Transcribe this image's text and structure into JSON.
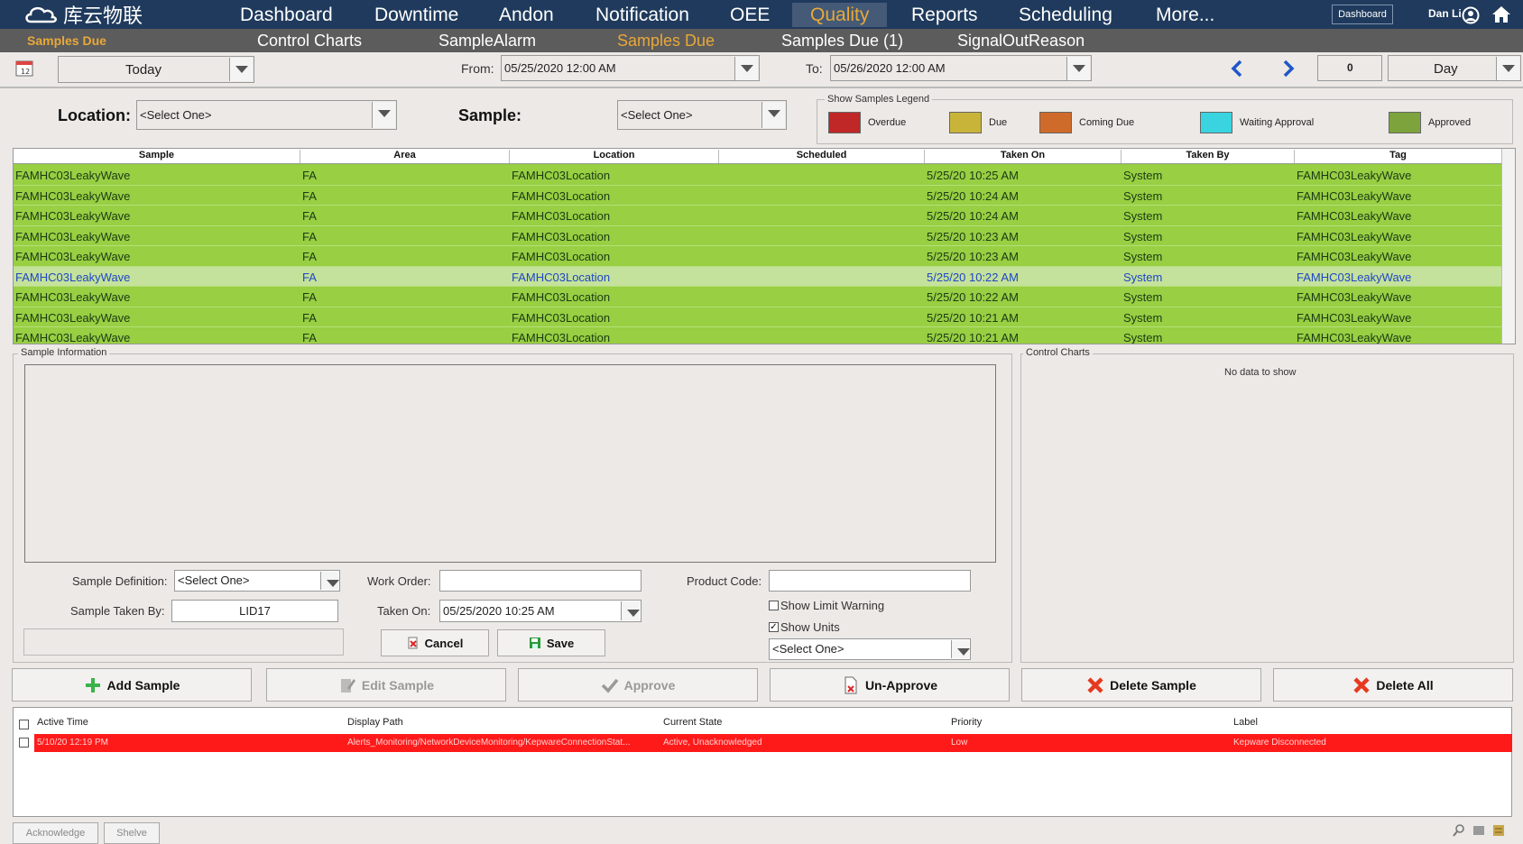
{
  "topnav": {
    "logo_text": "库云物联",
    "items": [
      "Dashboard",
      "Downtime",
      "Andon",
      "Notification",
      "OEE",
      "Quality",
      "Reports",
      "Scheduling",
      "More..."
    ],
    "dashboard_button": "Dashboard",
    "user": "Dan Li"
  },
  "subnav": {
    "page_title": "Samples Due",
    "items": [
      "Control Charts",
      "SampleAlarm",
      "Samples Due",
      "Samples Due (1)",
      "SignalOutReason"
    ]
  },
  "toolbar": {
    "range_value": "Today",
    "from_label": "From:",
    "from_value": "05/25/2020 12:00 AM",
    "to_label": "To:",
    "to_value": "05/26/2020 12:00 AM",
    "offset_value": "0",
    "period_value": "Day"
  },
  "filters": {
    "location_label": "Location:",
    "location_value": "<Select One>",
    "sample_label": "Sample:",
    "sample_value": "<Select One>"
  },
  "legend": {
    "title": "Show Samples Legend",
    "items": [
      {
        "label": "Overdue",
        "color": "#c02727"
      },
      {
        "label": "Due",
        "color": "#c9b43a"
      },
      {
        "label": "Coming Due",
        "color": "#cf6b2a"
      },
      {
        "label": "Waiting Approval",
        "color": "#39d4e0"
      },
      {
        "label": "Approved",
        "color": "#7da43c"
      }
    ]
  },
  "grid": {
    "columns": [
      "Sample",
      "Area",
      "Location",
      "Scheduled",
      "Taken On",
      "Taken By",
      "Tag"
    ],
    "rows": [
      [
        "FAMHC03LeakyWave",
        "FA",
        "FAMHC03Location",
        "",
        "5/25/20 10:25 AM",
        "System",
        "FAMHC03LeakyWave"
      ],
      [
        "FAMHC03LeakyWave",
        "FA",
        "FAMHC03Location",
        "",
        "5/25/20 10:24 AM",
        "System",
        "FAMHC03LeakyWave"
      ],
      [
        "FAMHC03LeakyWave",
        "FA",
        "FAMHC03Location",
        "",
        "5/25/20 10:24 AM",
        "System",
        "FAMHC03LeakyWave"
      ],
      [
        "FAMHC03LeakyWave",
        "FA",
        "FAMHC03Location",
        "",
        "5/25/20 10:23 AM",
        "System",
        "FAMHC03LeakyWave"
      ],
      [
        "FAMHC03LeakyWave",
        "FA",
        "FAMHC03Location",
        "",
        "5/25/20 10:23 AM",
        "System",
        "FAMHC03LeakyWave"
      ],
      [
        "FAMHC03LeakyWave",
        "FA",
        "FAMHC03Location",
        "",
        "5/25/20 10:22 AM",
        "System",
        "FAMHC03LeakyWave"
      ],
      [
        "FAMHC03LeakyWave",
        "FA",
        "FAMHC03Location",
        "",
        "5/25/20 10:22 AM",
        "System",
        "FAMHC03LeakyWave"
      ],
      [
        "FAMHC03LeakyWave",
        "FA",
        "FAMHC03Location",
        "",
        "5/25/20 10:21 AM",
        "System",
        "FAMHC03LeakyWave"
      ],
      [
        "FAMHC03LeakyWave",
        "FA",
        "FAMHC03Location",
        "",
        "5/25/20 10:21 AM",
        "System",
        "FAMHC03LeakyWave"
      ]
    ]
  },
  "sample_info": {
    "title": "Sample Information",
    "definition_label": "Sample Definition:",
    "definition_value": "<Select One>",
    "taken_by_label": "Sample Taken By:",
    "taken_by_value": "LID17",
    "work_order_label": "Work Order:",
    "work_order_value": "",
    "taken_on_label": "Taken On:",
    "taken_on_value": "05/25/2020 10:25 AM",
    "product_code_label": "Product Code:",
    "product_code_value": "",
    "show_limit_warning": "Show Limit Warning",
    "show_units": "Show Units",
    "units_value": "<Select One>",
    "cancel": "Cancel",
    "save": "Save"
  },
  "control_charts": {
    "title": "Control Charts",
    "empty_text": "No data to show"
  },
  "actions": {
    "add": "Add Sample",
    "edit": "Edit Sample",
    "approve": "Approve",
    "unapprove": "Un-Approve",
    "delete": "Delete Sample",
    "delete_all": "Delete All"
  },
  "alarms": {
    "columns": [
      "Active Time",
      "Display Path",
      "Current State",
      "Priority",
      "Label"
    ],
    "rows": [
      [
        "5/10/20 12:19 PM",
        "Alerts_Monitoring/NetworkDeviceMonitoring/KepwareConnectionStat...",
        "Active, Unacknowledged",
        "Low",
        "Kepware Disconnected"
      ]
    ],
    "acknowledge": "Acknowledge",
    "shelve": "Shelve"
  }
}
